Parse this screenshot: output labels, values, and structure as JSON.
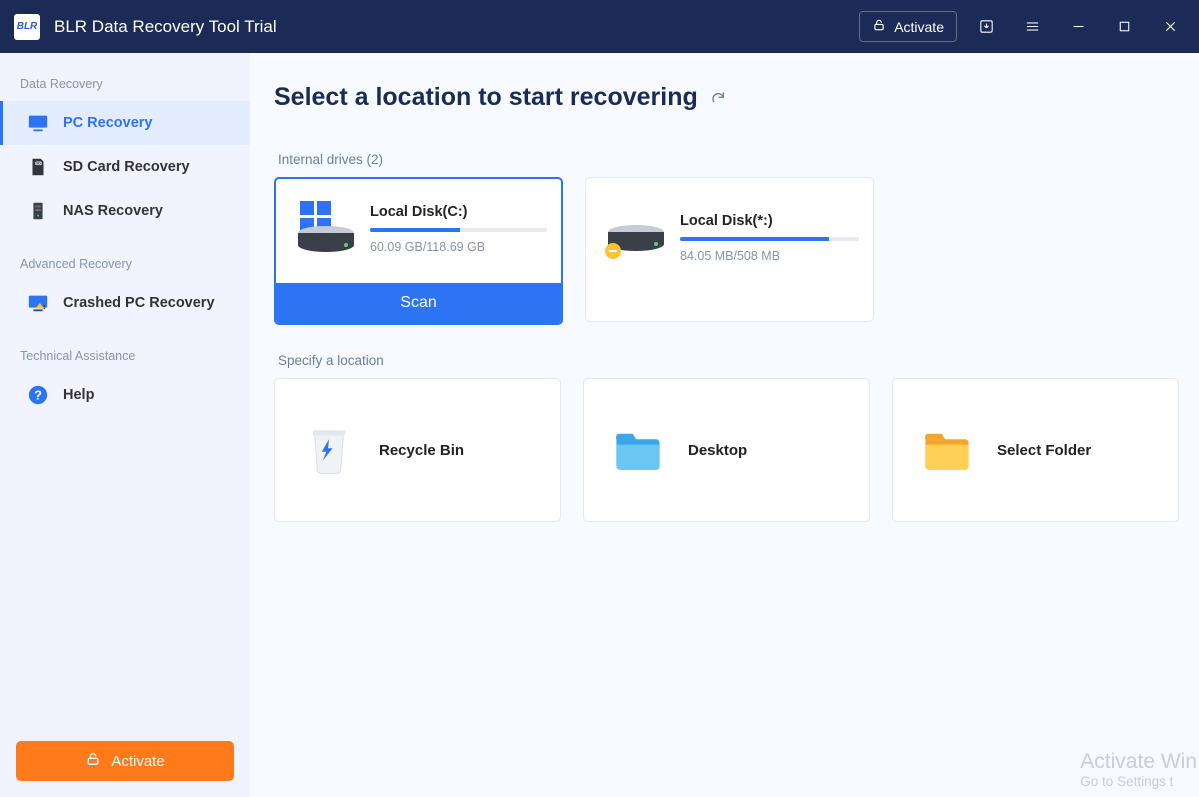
{
  "titlebar": {
    "logo_text": "BLR",
    "app_title": "BLR Data Recovery Tool Trial",
    "activate_label": "Activate"
  },
  "sidebar": {
    "section_data_recovery": "Data Recovery",
    "item_pc": "PC Recovery",
    "item_sd": "SD Card Recovery",
    "item_nas": "NAS Recovery",
    "section_advanced": "Advanced Recovery",
    "item_crashed": "Crashed PC Recovery",
    "section_tech": "Technical Assistance",
    "item_help": "Help",
    "activate_button": "Activate"
  },
  "main": {
    "page_title": "Select a location to start recovering",
    "internal_drives_label": "Internal drives (2)",
    "specify_location_label": "Specify a location",
    "scan_label": "Scan",
    "drives": [
      {
        "name": "Local Disk(C:)",
        "usage": "60.09 GB/118.69 GB",
        "fill_pct": 51
      },
      {
        "name": "Local Disk(*:)",
        "usage": "84.05 MB/508 MB",
        "fill_pct": 83
      }
    ],
    "locations": {
      "recycle": "Recycle Bin",
      "desktop": "Desktop",
      "select_folder": "Select Folder"
    }
  },
  "watermark": {
    "line1": "Activate Win",
    "line2": "Go to Settings t"
  }
}
